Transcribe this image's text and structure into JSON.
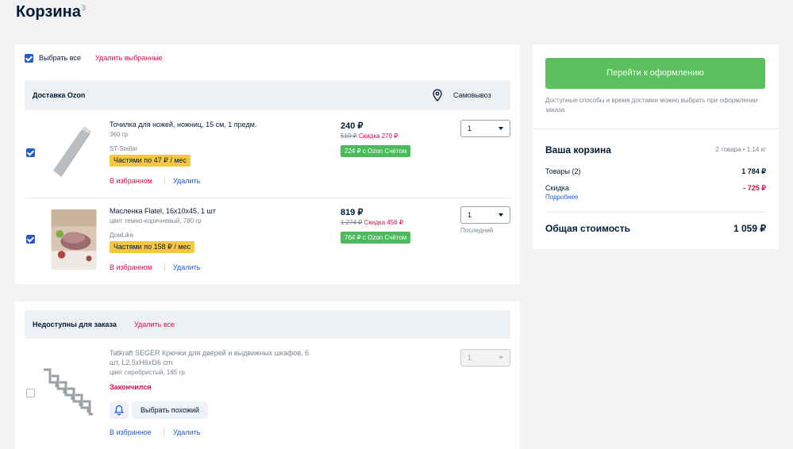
{
  "page": {
    "title": "Корзина",
    "count": "3"
  },
  "cart": {
    "select_all": "Выбрать все",
    "delete_selected": "Удалить выбранные",
    "group_title": "Доставка Ozon",
    "pickup_label": "Самовывоз",
    "items": [
      {
        "name": "Точилка для ножей, ножниц, 15 см, 1 предм.",
        "meta": "360 гр",
        "seller": "ST-Stellar",
        "installment": "Частями по 47 ₽ / мес",
        "price": "240 ₽",
        "old_price": "510 ₽",
        "discount": "Скидка 270 ₽",
        "card_price": "224 ₽ с Ozon Счётом",
        "qty": "1",
        "qty_note": "",
        "fav": "В избранном",
        "delete": "Удалить"
      },
      {
        "name": "Масленка Flatel, 16x10x45, 1 шт",
        "meta": "цвет темно-коричневый, 780 гр",
        "seller": "ДомLike",
        "installment": "Частями по 158 ₽ / мес",
        "price": "819 ₽",
        "old_price": "1 274 ₽",
        "discount": "Скидка 456 ₽",
        "card_price": "764 ₽ с Ozon Счётом",
        "qty": "1",
        "qty_note": "Последний",
        "fav": "В избранном",
        "delete": "Удалить"
      }
    ]
  },
  "unavailable": {
    "title": "Недоступны для заказа",
    "delete_all": "Удалить все",
    "item": {
      "name_line1": "Tatkraft SEGER Крючки для дверей и выдвижных шкафов, 6",
      "name_line2": "шт, L2.5xH6xD6 cm",
      "meta": "цвет серебристый, 165 гр",
      "status": "Закончился",
      "similar": "Выбрать похожий",
      "qty": "1",
      "fav": "В избранное",
      "delete": "Удалить"
    }
  },
  "summary": {
    "checkout": "Перейти к оформлению",
    "note": "Доступные способы и время доставки можно выбрать при оформлении заказа",
    "title": "Ваша корзина",
    "weight": "2 товара • 1.14 кг",
    "goods_label": "Товары (2)",
    "goods_value": "1 784 ₽",
    "discount_label": "Скидка",
    "discount_value": "- 725 ₽",
    "more": "Подробнее",
    "total_label": "Общая стоимость",
    "total_value": "1 059 ₽"
  },
  "colors": {
    "accent_blue": "#1c5bdc",
    "green": "#5bc15f",
    "red": "#e30c4a",
    "yellow": "#f7c742"
  }
}
